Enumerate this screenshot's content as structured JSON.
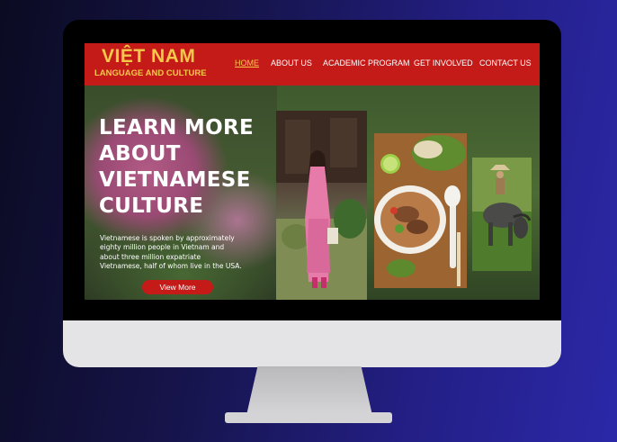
{
  "site": {
    "brand_title": "VIỆT NAM",
    "brand_subtitle": "LANGUAGE AND CULTURE"
  },
  "nav": {
    "items": [
      {
        "label": "HOME",
        "active": true
      },
      {
        "label": "ABOUT US",
        "active": false
      },
      {
        "label": "ACADEMIC PROGRAM",
        "active": false
      },
      {
        "label": "GET INVOLVED",
        "active": false
      },
      {
        "label": "CONTACT US",
        "active": false
      }
    ]
  },
  "hero": {
    "heading_lines": [
      "LEARN MORE",
      "ABOUT",
      "VIETNAMESE",
      "CULTURE"
    ],
    "body_lines": [
      "Vietnamese is spoken by approximately",
      "eighty million people in Vietnam and",
      "about three million expatriate",
      "Vietnamese, half of whom live in the USA."
    ],
    "cta_label": "View More"
  },
  "colors": {
    "nav_bg": "#c41a18",
    "brand_yellow": "#f4c94a",
    "cta_bg": "#c41a18",
    "page_bg_start": "#0b0b22",
    "page_bg_end": "#2b28a8"
  }
}
